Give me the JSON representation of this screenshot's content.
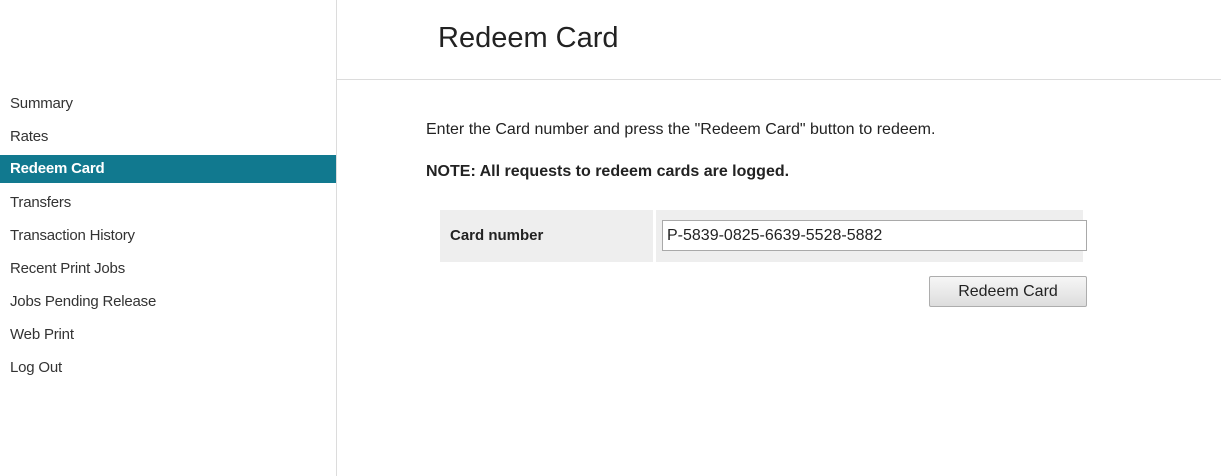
{
  "sidebar": {
    "items": [
      {
        "label": "Summary",
        "active": false
      },
      {
        "label": "Rates",
        "active": false
      },
      {
        "label": "Redeem Card",
        "active": true
      },
      {
        "label": "Transfers",
        "active": false
      },
      {
        "label": "Transaction History",
        "active": false
      },
      {
        "label": "Recent Print Jobs",
        "active": false
      },
      {
        "label": "Jobs Pending Release",
        "active": false
      },
      {
        "label": "Web Print",
        "active": false
      },
      {
        "label": "Log Out",
        "active": false
      }
    ]
  },
  "header": {
    "title": "Redeem Card"
  },
  "main": {
    "instructions": "Enter the Card number and press the \"Redeem Card\" button to redeem.",
    "note": "NOTE: All requests to redeem cards are logged.",
    "form": {
      "card_label": "Card number",
      "card_value": "P-5839-0825-6639-5528-5882",
      "submit_label": "Redeem Card"
    }
  },
  "colors": {
    "active_nav_bg": "#11798f",
    "active_nav_text": "#ffffff",
    "form_bg": "#eeeeee",
    "divider": "#dcdcdc"
  }
}
